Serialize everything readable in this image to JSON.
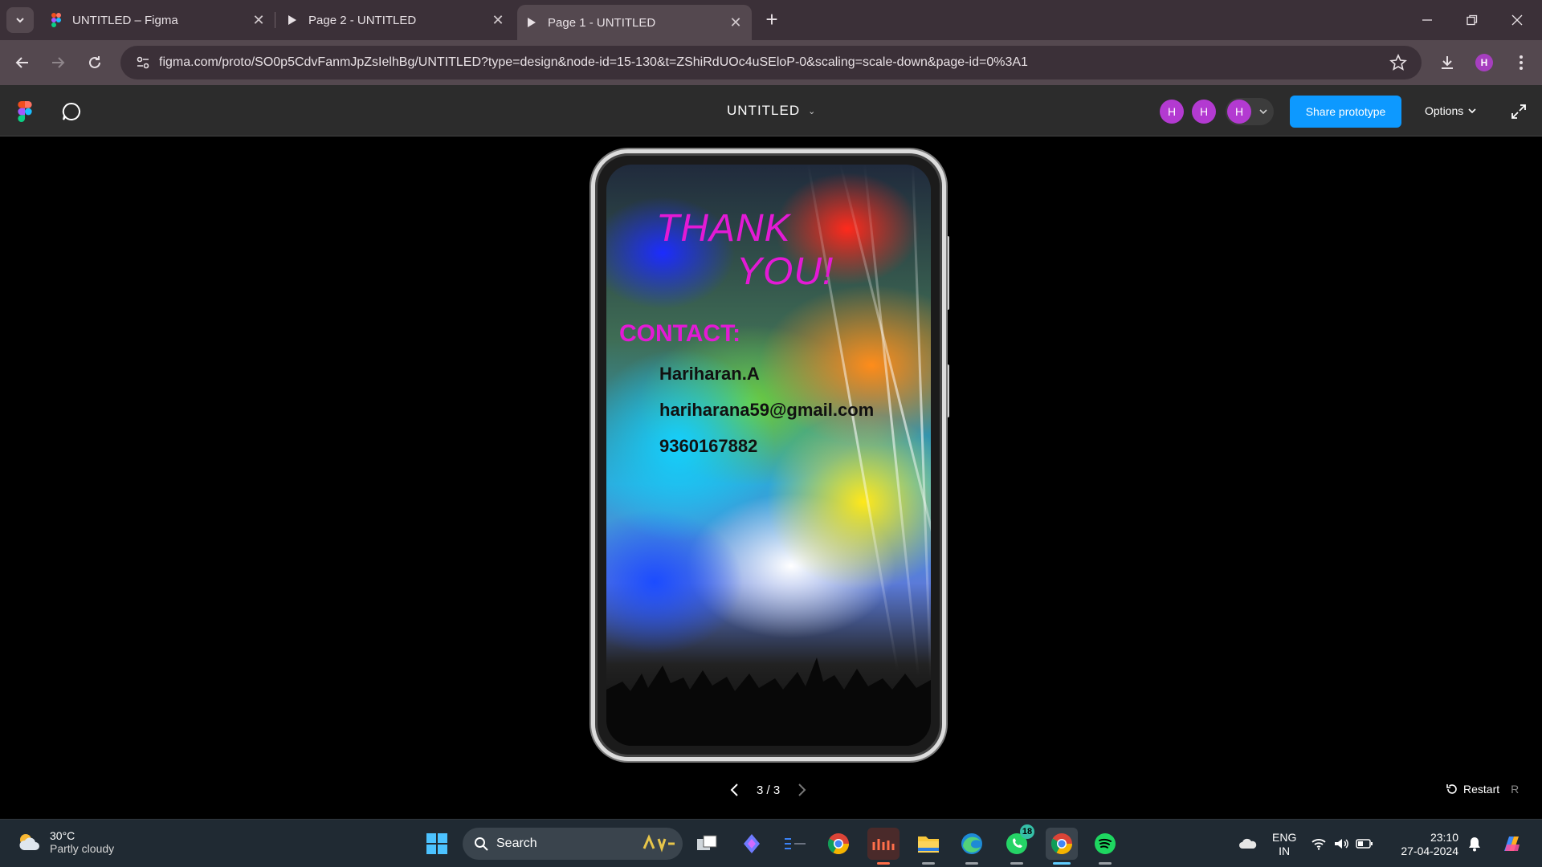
{
  "browser": {
    "tabs": [
      {
        "title": "UNTITLED – Figma",
        "active": false
      },
      {
        "title": "Page 2 - UNTITLED",
        "active": false
      },
      {
        "title": "Page 1 - UNTITLED",
        "active": true
      }
    ],
    "url": "figma.com/proto/SO0p5CdvFanmJpZsIelhBg/UNTITLED?type=design&node-id=15-130&t=ZShiRdUOc4uSEloP-0&scaling=scale-down&page-id=0%3A1",
    "profile_initial": "H"
  },
  "figma": {
    "file_title": "UNTITLED",
    "avatars": [
      "H",
      "H",
      "H"
    ],
    "share_label": "Share prototype",
    "options_label": "Options"
  },
  "slide": {
    "heading_line1": "THANK",
    "heading_line2": "YOU!",
    "contact_label": "CONTACT:",
    "name": "Hariharan.A",
    "email": "hariharana59@gmail.com",
    "phone": "9360167882"
  },
  "pager": {
    "text": "3 / 3"
  },
  "restart": {
    "label": "Restart",
    "shortcut": "R"
  },
  "taskbar": {
    "weather_temp": "30°C",
    "weather_cond": "Partly cloudy",
    "search_label": "Search",
    "whatsapp_badge": "18",
    "lang_line1": "ENG",
    "lang_line2": "IN",
    "time": "23:10",
    "date": "27-04-2024"
  },
  "colors": {
    "accent_blue": "#0d99ff",
    "heading_magenta": "#e31ad5",
    "avatar_purple": "#b33ad1"
  }
}
